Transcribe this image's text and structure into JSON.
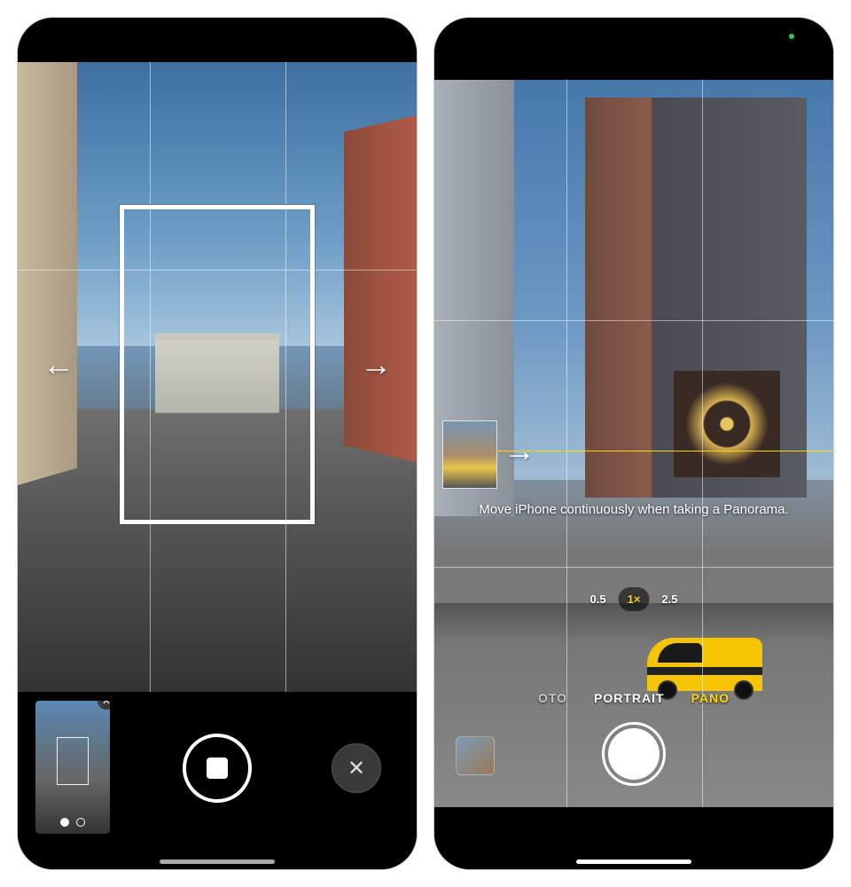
{
  "left_phone": {
    "arrow_left": "←",
    "arrow_right": "→",
    "thumbnail_close": "✕",
    "cancel_label": "✕"
  },
  "right_phone": {
    "instruction": "Move iPhone continuously when taking a Panorama.",
    "zoom_options": [
      "0.5",
      "1×",
      "2.5"
    ],
    "selected_zoom": "1×",
    "modes": [
      {
        "label": "OTO",
        "state": "dim"
      },
      {
        "label": "PORTRAIT",
        "state": "normal"
      },
      {
        "label": "PANO",
        "state": "active"
      }
    ],
    "pano_arrow": "→"
  }
}
